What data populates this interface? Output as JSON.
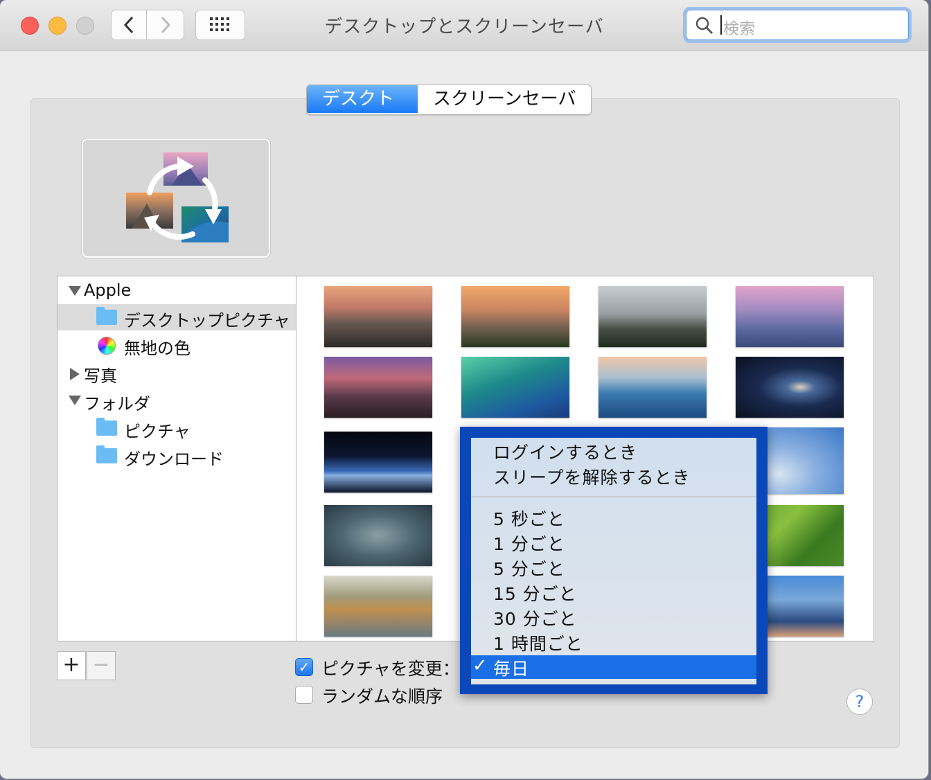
{
  "window": {
    "title": "デスクトップとスクリーンセーバ",
    "search_placeholder": "検索"
  },
  "tabs": [
    {
      "label": "デスクトップ",
      "active": true
    },
    {
      "label": "スクリーンセーバ",
      "active": false
    }
  ],
  "sourcelist": {
    "apple": "Apple",
    "desktop_pictures": "デスクトップピクチャ",
    "solid_colors": "無地の色",
    "photos": "写真",
    "folders": "フォルダ",
    "pictures": "ピクチャ",
    "downloads": "ダウンロード"
  },
  "controls": {
    "add": "+",
    "remove": "−",
    "change_picture": "ピクチャを変更：",
    "change_picture_checked": true,
    "random_order": "ランダムな順序",
    "random_order_checked": false,
    "help": "?"
  },
  "menu": {
    "items": [
      "ログインするとき",
      "スリープを解除するとき",
      "5 秒ごと",
      "1 分ごと",
      "5 分ごと",
      "15 分ごと",
      "30 分ごと",
      "1 時間ごと"
    ],
    "selected": "毎日",
    "check": "✓"
  }
}
